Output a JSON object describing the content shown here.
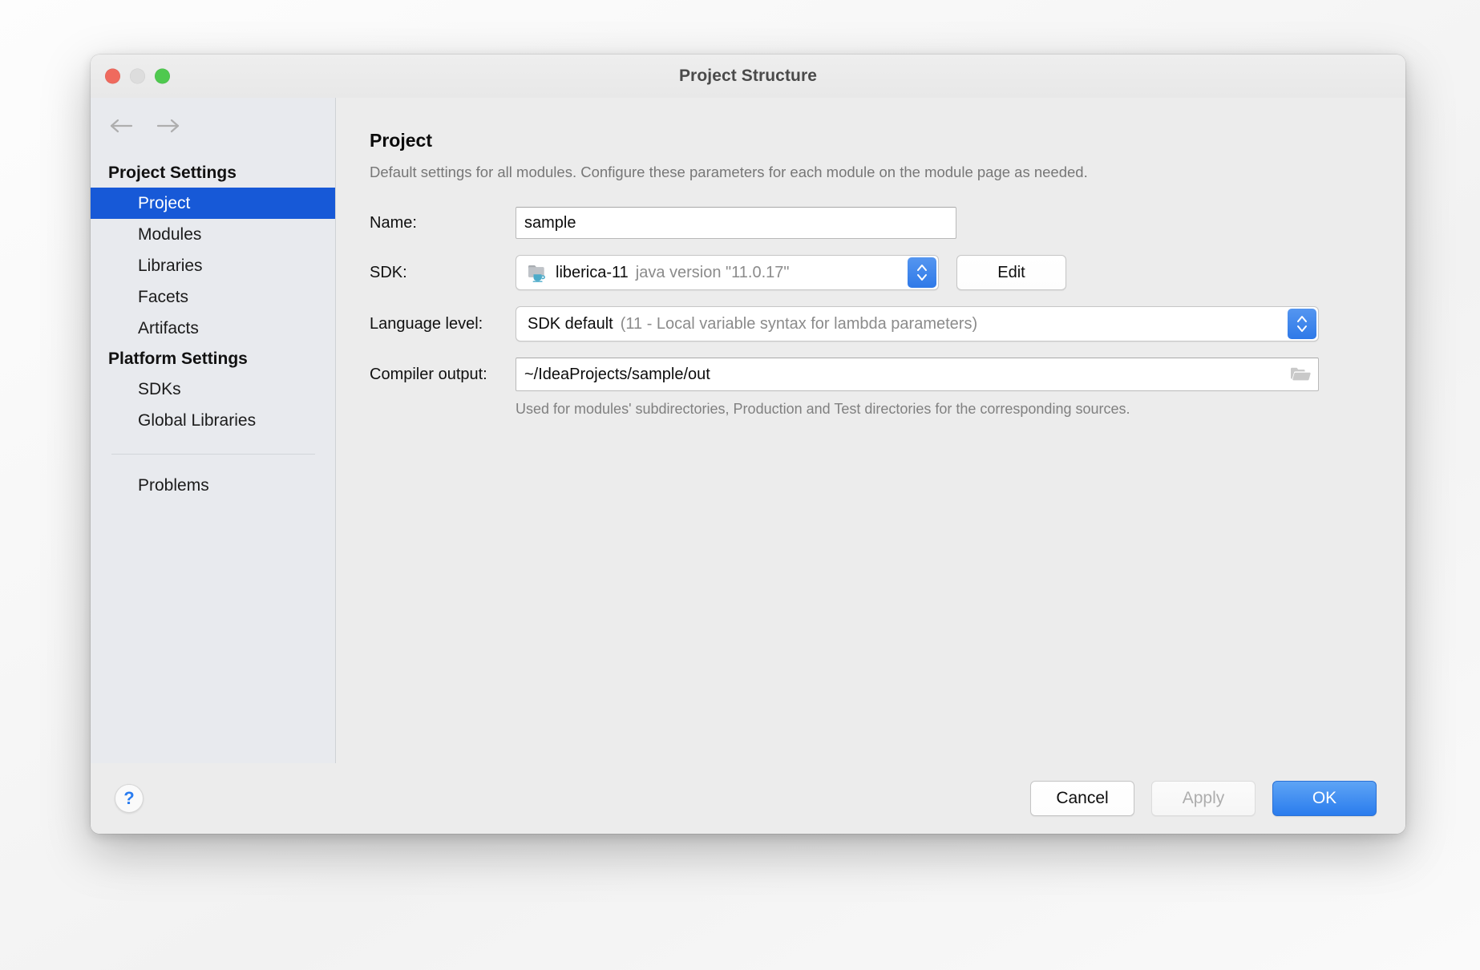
{
  "window": {
    "title": "Project Structure",
    "traffic_lights": [
      "close",
      "minimize",
      "zoom"
    ]
  },
  "sidebar": {
    "nav_back": "back-arrow",
    "nav_forward": "forward-arrow",
    "groups": [
      {
        "heading": "Project Settings",
        "items": [
          {
            "label": "Project",
            "selected": true
          },
          {
            "label": "Modules",
            "selected": false
          },
          {
            "label": "Libraries",
            "selected": false
          },
          {
            "label": "Facets",
            "selected": false
          },
          {
            "label": "Artifacts",
            "selected": false
          }
        ]
      },
      {
        "heading": "Platform Settings",
        "items": [
          {
            "label": "SDKs",
            "selected": false
          },
          {
            "label": "Global Libraries",
            "selected": false
          }
        ]
      }
    ],
    "footer_items": [
      {
        "label": "Problems",
        "selected": false
      }
    ]
  },
  "main": {
    "title": "Project",
    "description": "Default settings for all modules. Configure these parameters for each module on the module page as needed.",
    "fields": {
      "name": {
        "label": "Name:",
        "value": "sample"
      },
      "sdk": {
        "label": "SDK:",
        "icon": "java-sdk-folder-icon",
        "value": "liberica-11",
        "detail": "java version \"11.0.17\"",
        "edit_button": "Edit"
      },
      "language_level": {
        "label": "Language level:",
        "value": "SDK default",
        "detail": "(11 - Local variable syntax for lambda parameters)"
      },
      "compiler_output": {
        "label": "Compiler output:",
        "value": "~/IdeaProjects/sample/out",
        "browse_icon": "folder-open-icon",
        "hint": "Used for modules' subdirectories, Production and Test directories for the corresponding sources."
      }
    }
  },
  "footer": {
    "help": "?",
    "cancel": "Cancel",
    "apply": "Apply",
    "ok": "OK"
  },
  "colors": {
    "selection_blue": "#1759d7",
    "accent_blue": "#2a7ced",
    "sidebar_bg": "#e8eaee",
    "content_bg": "#ececec"
  }
}
